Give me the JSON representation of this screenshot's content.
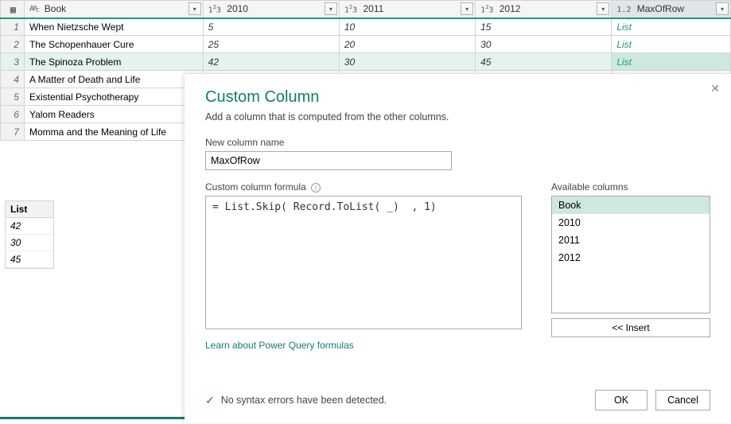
{
  "columns": {
    "book": "Book",
    "y2010": "2010",
    "y2011": "2011",
    "y2012": "2012",
    "max": "MaxOfRow"
  },
  "rows": [
    {
      "n": "1",
      "book": "When Nietzsche Wept",
      "y2010": "5",
      "y2011": "10",
      "y2012": "15",
      "max": "List"
    },
    {
      "n": "2",
      "book": "The Schopenhauer Cure",
      "y2010": "25",
      "y2011": "20",
      "y2012": "30",
      "max": "List"
    },
    {
      "n": "3",
      "book": "The Spinoza Problem",
      "y2010": "42",
      "y2011": "30",
      "y2012": "45",
      "max": "List"
    },
    {
      "n": "4",
      "book": "A Matter of Death and Life",
      "y2010": "",
      "y2011": "",
      "y2012": "",
      "max": ""
    },
    {
      "n": "5",
      "book": "Existential Psychotherapy",
      "y2010": "",
      "y2011": "",
      "y2012": "",
      "max": ""
    },
    {
      "n": "6",
      "book": "Yalom Readers",
      "y2010": "",
      "y2011": "",
      "y2012": "",
      "max": ""
    },
    {
      "n": "7",
      "book": "Momma and the Meaning of Life",
      "y2010": "",
      "y2011": "",
      "y2012": "",
      "max": ""
    }
  ],
  "list_preview": {
    "header": "List",
    "vals": [
      "42",
      "30",
      "45"
    ]
  },
  "dialog": {
    "title": "Custom Column",
    "desc": "Add a column that is computed from the other columns.",
    "name_label": "New column name",
    "name_value": "MaxOfRow",
    "formula_label": "Custom column formula",
    "formula_value": "= List.Skip( Record.ToList( _)  , 1)",
    "avail_label": "Available columns",
    "avail_items": [
      "Book",
      "2010",
      "2011",
      "2012"
    ],
    "insert_label": "<< Insert",
    "learn_link": "Learn about Power Query formulas",
    "syntax_msg": "No syntax errors have been detected.",
    "ok": "OK",
    "cancel": "Cancel"
  }
}
